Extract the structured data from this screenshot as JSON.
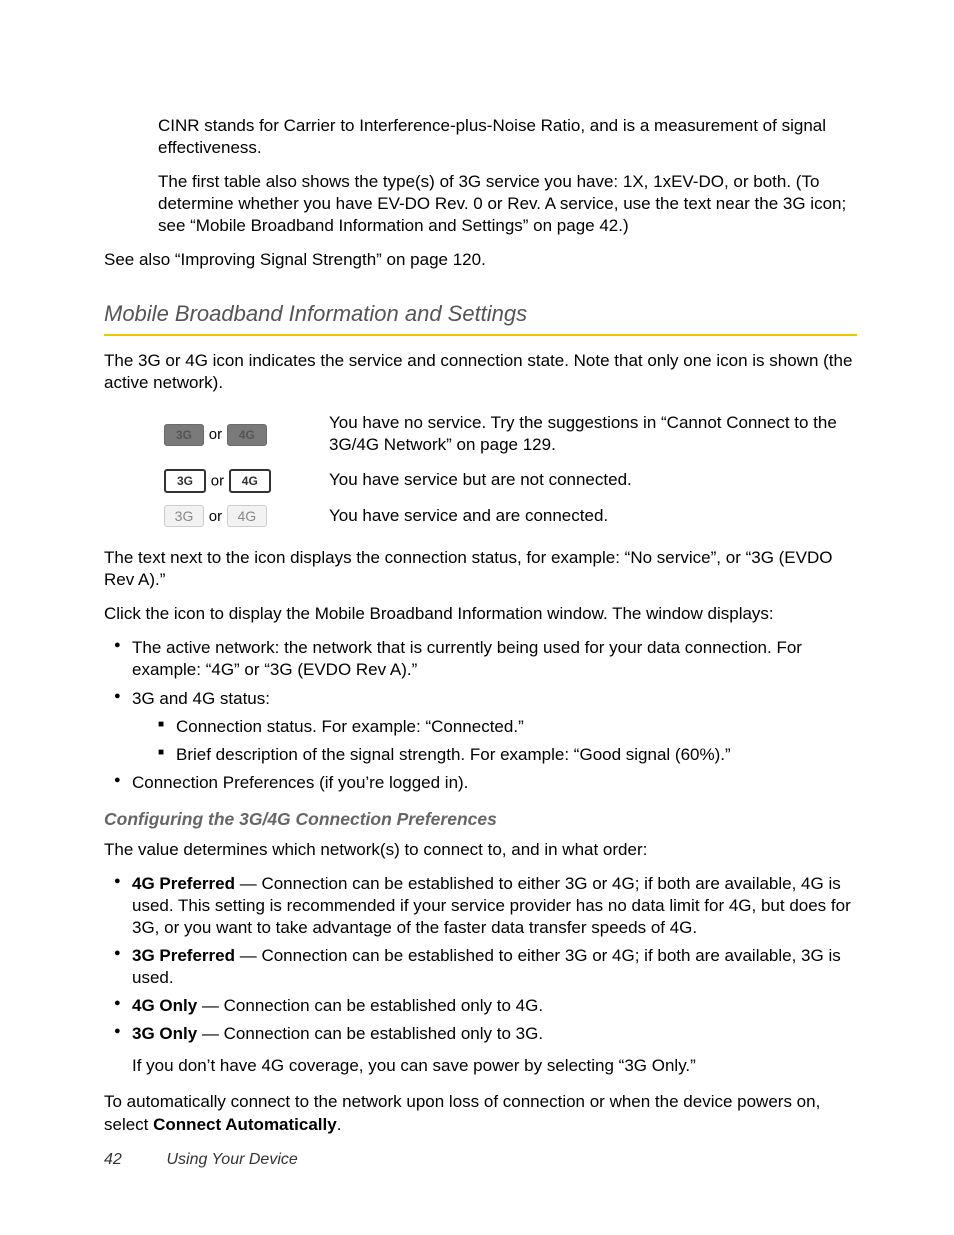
{
  "intro": {
    "p1": "CINR stands for Carrier to Interference-plus-Noise Ratio, and is a measurement of signal effectiveness.",
    "p2": "The first table also shows the type(s) of 3G service you have: 1X, 1xEV-DO, or both. (To determine whether you have EV-DO Rev. 0 or Rev. A service, use the text near the 3G icon; see “Mobile Broadband Information and Settings” on page 42.)",
    "p3": "See also “Improving Signal Strength” on page 120."
  },
  "section": {
    "title": "Mobile Broadband Information and Settings",
    "lead": "The 3G or 4G icon indicates the service and connection state. Note that only one icon is shown (the active network).",
    "rows": [
      {
        "i3": "3G",
        "or": "or",
        "i4": "4G",
        "desc": "You have no service. Try the suggestions in “Cannot Connect to the 3G/4G Network” on page 129."
      },
      {
        "i3": "3G",
        "or": "or",
        "i4": "4G",
        "desc": "You have service but are not connected."
      },
      {
        "i3": "3G",
        "or": "or",
        "i4": "4G",
        "desc": "You have service and are connected."
      }
    ],
    "after1": "The text next to the icon displays the connection status, for example: “No service”, or “3G (EVDO Rev A).”",
    "after2": "Click the icon to display the Mobile Broadband Information window. The window displays:",
    "bullets": {
      "b1": "The active network: the network that is currently being used for your data connection. For example: “4G” or “3G (EVDO Rev A).”",
      "b2": "3G and 4G status:",
      "b2a": "Connection status. For example: “Connected.”",
      "b2b": "Brief description of the signal strength. For example: “Good signal (60%).”",
      "b3": "Connection Preferences (if you’re logged in)."
    }
  },
  "sub": {
    "title": "Configuring the 3G/4G Connection Preferences",
    "lead": "The value determines which network(s) to connect to, and in what order:",
    "items": {
      "i1b": "4G Preferred",
      "i1t": " — Connection can be established to either 3G or 4G; if both are available, 4G is used. This setting is recommended if your service provider has no data limit for 4G, but does for 3G, or you want to take advantage of the faster data transfer speeds of 4G.",
      "i2b": "3G Preferred",
      "i2t": " — Connection can be established to either 3G or 4G; if both are available, 3G is used.",
      "i3b": "4G Only",
      "i3t": " — Connection can be established only to 4G.",
      "i4b": "3G Only",
      "i4t": " — Connection can be established only to 3G.",
      "follow": "If you don’t have 4G coverage, you can save power by selecting “3G Only.”"
    },
    "tail_pre": "To automatically connect to the network upon loss of connection or when the device powers on, select ",
    "tail_b": "Connect Automatically",
    "tail_post": "."
  },
  "footer": {
    "page": "42",
    "chapter": "Using Your Device"
  }
}
